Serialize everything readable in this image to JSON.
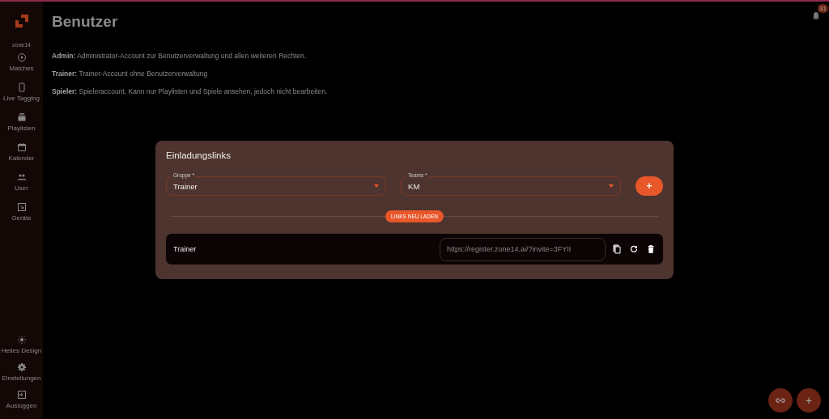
{
  "sidebar": {
    "brand": "zone14",
    "items": [
      {
        "label": "Matches"
      },
      {
        "label": "Live Tagging"
      },
      {
        "label": "Playlisten"
      },
      {
        "label": "Kalender"
      },
      {
        "label": "User"
      },
      {
        "label": "Geräte"
      }
    ],
    "bottom_items": [
      {
        "label": "Helles Design"
      },
      {
        "label": "Einstellungen"
      },
      {
        "label": "Ausloggen"
      }
    ]
  },
  "title": "Benutzer",
  "notifications": {
    "count": "31"
  },
  "roles": [
    {
      "text": "**Admin:** Administrator-Account zur Benutzerverwaltung und allen weiteren Rechten."
    },
    {
      "text": "**Trainer:** Trainer-Account ohne Benutzerverwaltung"
    },
    {
      "text": "**Spieler:** Spieleraccount. Kann nur Playlisten und Spiele ansehen, jedoch nicht bearbeiten."
    }
  ],
  "dialog": {
    "title": "Einladungslinks",
    "fields": [
      {
        "label": "Gruppe *",
        "value": "Trainer"
      },
      {
        "label": "Teams *",
        "value": "KM"
      }
    ],
    "add_button": "+",
    "reload_button": "LINKS NEU LADEN",
    "links": [
      {
        "group": "Trainer",
        "url": "https://register.zone14.ai/?invite=3FYII"
      }
    ]
  },
  "fab": {
    "add": "+"
  }
}
